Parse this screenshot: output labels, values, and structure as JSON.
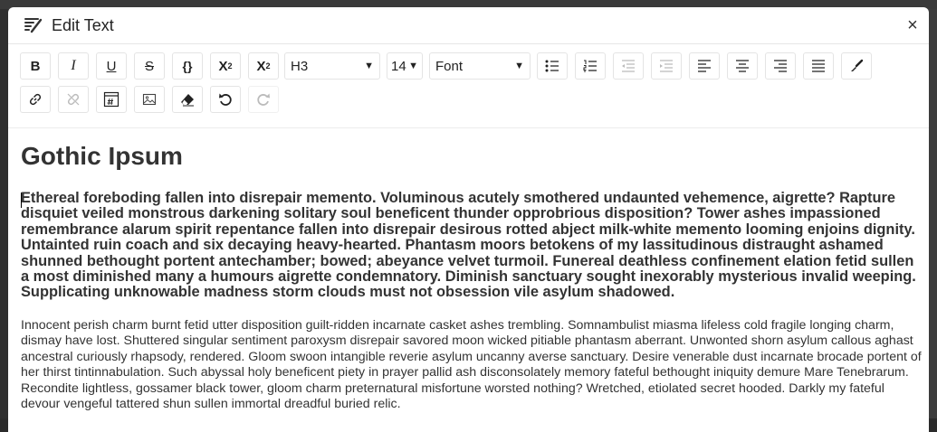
{
  "dialog": {
    "title": "Edit Text",
    "close_glyph": "×"
  },
  "toolbar": {
    "bold": "B",
    "italic": "I",
    "underline": "U",
    "strike": "S",
    "code": "{}",
    "superscript_base": "X",
    "superscript_mark": "2",
    "subscript_base": "X",
    "subscript_mark": "2",
    "heading_select": "H3",
    "size_select": "14",
    "font_select": "Font",
    "icons": [
      "bullet-list-icon",
      "numbered-list-icon",
      "outdent-icon",
      "indent-icon",
      "align-left-icon",
      "align-center-icon",
      "align-right-icon",
      "justify-icon",
      "brush-icon",
      "link-icon",
      "unlink-icon",
      "embed-icon",
      "image-icon",
      "eraser-icon",
      "undo-icon",
      "redo-icon"
    ]
  },
  "content": {
    "heading": "Gothic Ipsum",
    "bold_paragraph": "Ethereal foreboding fallen into disrepair memento. Voluminous acutely smothered undaunted vehemence, aigrette? Rapture disquiet veiled monstrous darkening solitary soul beneficent thunder opprobrious disposition? Tower ashes impassioned remembrance alarum spirit repentance fallen into disrepair desirous rotted abject milk-white memento looming enjoins dignity. Untainted ruin coach and six decaying heavy-hearted. Phantasm moors betokens of my lassitudinous distraught ashamed shunned bethought portent antechamber; bowed; abeyance velvet turmoil. Funereal deathless confinement elation fetid sullen a most diminished many a humours aigrette condemnatory. Diminish sanctuary sought inexorably mysterious invalid weeping. Supplicating unknowable madness storm clouds must not obsession vile asylum shadowed.",
    "normal_paragraph": "Innocent perish charm burnt fetid utter disposition guilt-ridden incarnate casket ashes trembling. Somnambulist miasma lifeless cold fragile longing charm, dismay have lost. Shuttered singular sentiment paroxysm disrepair savored moon wicked pitiable phantasm aberrant. Unwonted shorn asylum callous aghast ancestral curiously rhapsody, rendered. Gloom swoon intangible reverie asylum uncanny averse sanctuary. Desire venerable dust incarnate brocade portent of her thirst tintinnabulation. Such abyssal holy beneficent piety in prayer pallid ash disconsolately memory fateful bethought iniquity demure Mare Tenebrarum. Recondite lightless, gossamer black tower, gloom charm preternatural misfortune worsted nothing? Wretched, etiolated secret hooded. Darkly my fateful devour vengeful tattered shun sullen immortal dreadful buried relic."
  }
}
